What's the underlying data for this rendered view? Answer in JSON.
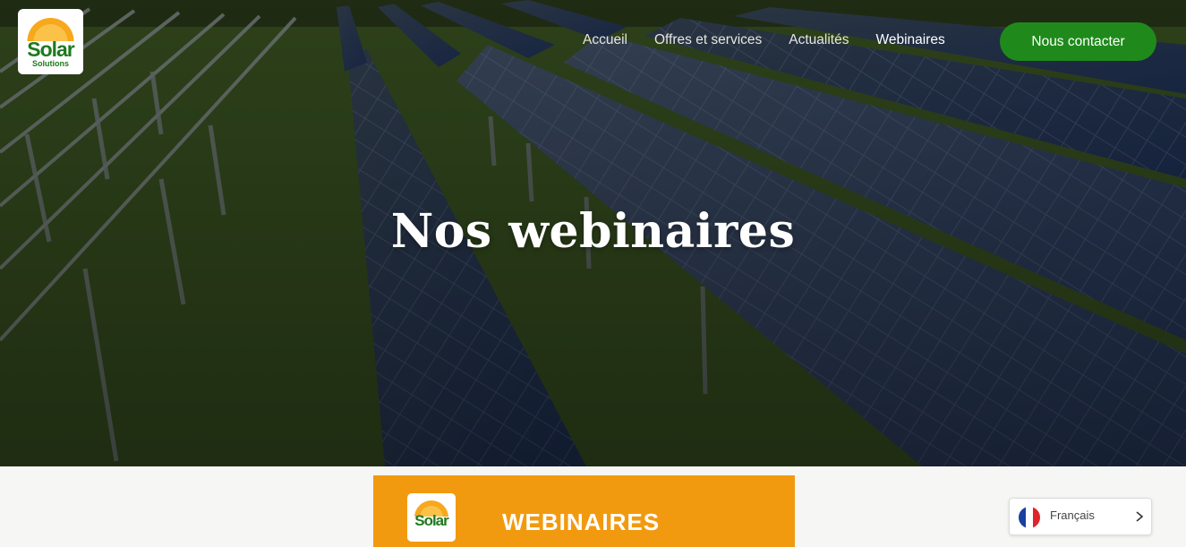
{
  "brand": {
    "name": "Solar",
    "tagline": "Solutions",
    "colors": {
      "green": "#1f8a1b",
      "orange": "#f29a0f",
      "sun": "#f7a81c"
    }
  },
  "nav": {
    "items": [
      {
        "label": "Accueil",
        "active": false
      },
      {
        "label": "Offres et services",
        "active": false
      },
      {
        "label": "Actualités",
        "active": false
      },
      {
        "label": "Webinaires",
        "active": true
      }
    ],
    "cta_label": "Nous contacter"
  },
  "hero": {
    "title": "Nos webinaires",
    "background": "solar-panel-field-photo"
  },
  "banner": {
    "logo_text": "Solar",
    "title": "WEBINAIRES"
  },
  "language": {
    "current": "Français",
    "flag": "france-flag-icon",
    "flag_colors": [
      "#1a3fa0",
      "#ffffff",
      "#e0242b"
    ]
  }
}
